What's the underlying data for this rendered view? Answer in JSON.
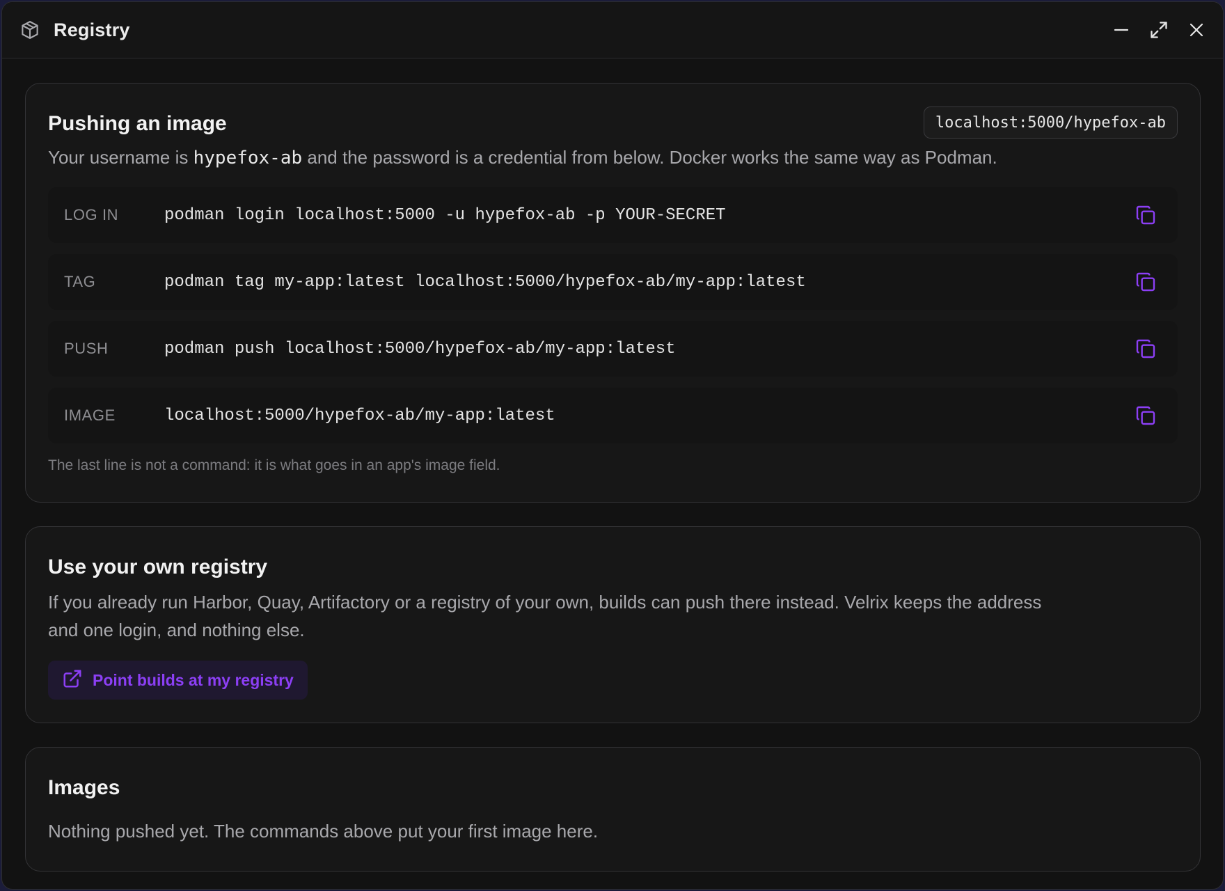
{
  "window": {
    "title": "Registry",
    "icons": {
      "app": "package-icon",
      "minimize": "minimize-icon",
      "maximize": "maximize-icon",
      "close": "close-icon"
    }
  },
  "push": {
    "title": "Pushing an image",
    "registry": "localhost:5000/hypefox-ab",
    "desc_before": "Your username is ",
    "username": "hypefox-ab",
    "desc_after": " and the password is a credential from below. Docker works the same way as Podman.",
    "commands": [
      {
        "label": "LOG IN",
        "text": "podman login localhost:5000 -u hypefox-ab -p YOUR-SECRET"
      },
      {
        "label": "TAG",
        "text": "podman tag my-app:latest localhost:5000/hypefox-ab/my-app:latest"
      },
      {
        "label": "PUSH",
        "text": "podman push localhost:5000/hypefox-ab/my-app:latest"
      },
      {
        "label": "IMAGE",
        "text": "localhost:5000/hypefox-ab/my-app:latest"
      }
    ],
    "note": "The last line is not a command: it is what goes in an app's image field."
  },
  "own": {
    "title": "Use your own registry",
    "desc": "If you already run Harbor, Quay, Artifactory or a registry of your own, builds can push there instead. Velrix keeps the address and one login, and nothing else.",
    "button_label": "Point builds at my registry",
    "button_icon": "external-link-icon"
  },
  "images": {
    "title": "Images",
    "empty": "Nothing pushed yet. The commands above put your first image here."
  },
  "colors": {
    "accent": "#8c3ff5",
    "background": "#121212",
    "card": "#171717",
    "outer": "#1b1c3a"
  }
}
